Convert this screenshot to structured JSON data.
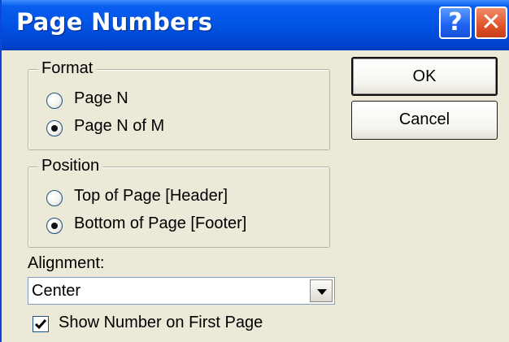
{
  "window": {
    "title": "Page Numbers"
  },
  "titlebar": {
    "help_glyph": "?",
    "close_glyph": "✕"
  },
  "format_group": {
    "label": "Format",
    "options": [
      {
        "label": "Page N",
        "checked": false
      },
      {
        "label": "Page N of M",
        "checked": true
      }
    ]
  },
  "position_group": {
    "label": "Position",
    "options": [
      {
        "label": "Top of Page [Header]",
        "checked": false
      },
      {
        "label": "Bottom of Page [Footer]",
        "checked": true
      }
    ]
  },
  "alignment": {
    "label": "Alignment:",
    "value": "Center"
  },
  "show_first_page": {
    "label": "Show Number on First Page",
    "checked": true
  },
  "buttons": {
    "ok": "OK",
    "cancel": "Cancel"
  }
}
